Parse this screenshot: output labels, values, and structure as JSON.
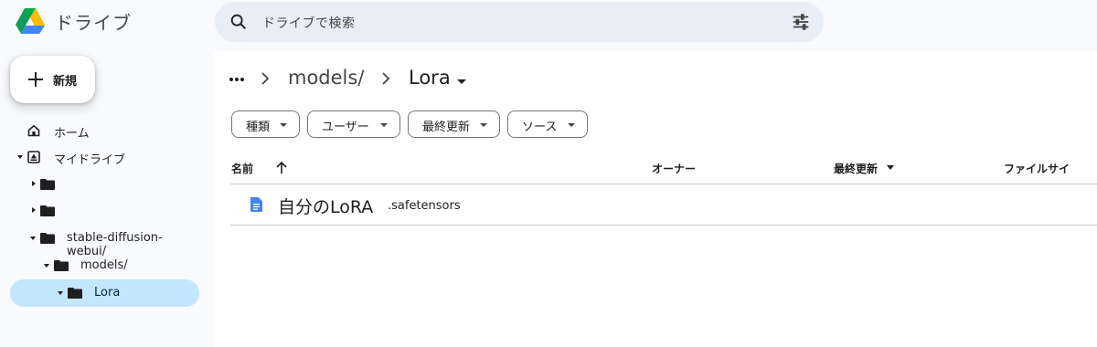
{
  "app": {
    "title": "ドライブ"
  },
  "search": {
    "placeholder": "ドライブで検索"
  },
  "sidebar": {
    "new_label": "新規",
    "home": "ホーム",
    "my_drive": "マイドライブ",
    "tree": [
      {
        "label": ""
      },
      {
        "label": ""
      },
      {
        "label": "stable-diffusion-webui/"
      },
      {
        "label": "models/"
      },
      {
        "label": "Lora"
      }
    ]
  },
  "breadcrumb": {
    "parent": "models/",
    "current": "Lora"
  },
  "filters": [
    "種類",
    "ユーザー",
    "最終更新",
    "ソース"
  ],
  "columns": {
    "name": "名前",
    "owner": "オーナー",
    "modified": "最終更新",
    "size": "ファイルサイ"
  },
  "files": [
    {
      "name": "自分のLoRA",
      "ext": ".safetensors",
      "icon": "document-icon"
    }
  ],
  "colors": {
    "accent": "#c2e7ff",
    "doc_blue": "#4285f4",
    "background": "#f8fafd"
  }
}
